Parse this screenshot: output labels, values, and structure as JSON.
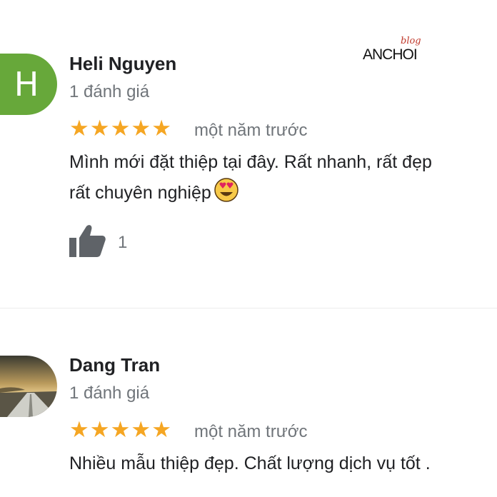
{
  "watermark": {
    "main": "ANCHOI",
    "script": "blog"
  },
  "reviews": [
    {
      "avatar_letter": "H",
      "name": "Heli Nguyen",
      "review_count": "1 đánh giá",
      "rating": 5,
      "time": "một năm trước",
      "text_line1": "Mình mới đặt thiệp tại đây. Rất nhanh, rất đẹp",
      "text_line2": "rất chuyên nghiệp",
      "emoji": "smiling-face-with-heart-eyes",
      "likes": "1"
    },
    {
      "name": "Dang Tran",
      "review_count": "1 đánh giá",
      "rating": 5,
      "time": "một năm trước",
      "text_line1": "Nhiều mẫu thiệp đẹp. Chất lượng dịch vụ tốt ."
    }
  ],
  "colors": {
    "star": "#f5a623",
    "avatar_h": "#67a83a",
    "muted": "#70757a"
  }
}
